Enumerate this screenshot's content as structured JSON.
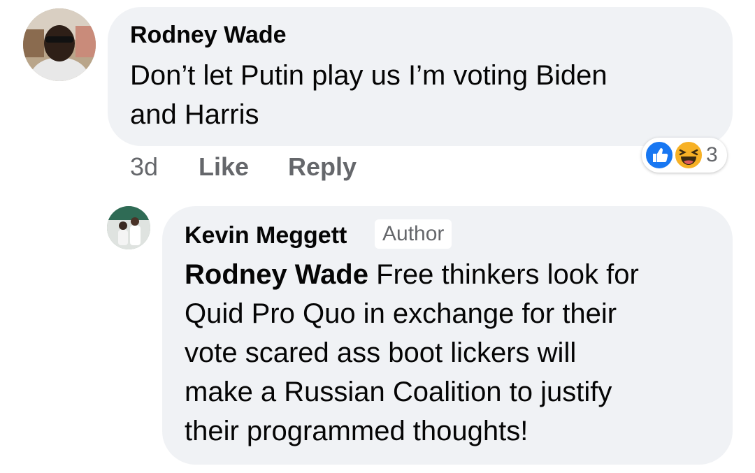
{
  "comments": [
    {
      "author": "Rodney Wade",
      "text_lines": [
        "Don’t let Putin play us I’m voting Biden",
        "and Harris"
      ],
      "actions": {
        "time": "3d",
        "like": "Like",
        "reply": "Reply"
      },
      "reactions": {
        "icons": [
          "like-reaction",
          "haha-reaction"
        ],
        "count": "3"
      }
    },
    {
      "author": "Kevin Meggett",
      "badge": "Author",
      "mention": "Rodney Wade",
      "text_lines": [
        " Free thinkers look for",
        "Quid Pro Quo in exchange for their",
        "vote scared ass boot lickers will",
        "make a Russian Coalition to justify",
        "their programmed thoughts!"
      ]
    }
  ],
  "colors": {
    "bubble": "#f0f2f5",
    "text": "#050505",
    "secondary": "#65676b",
    "like_blue": "#1877f2",
    "haha_yellow": "#f7b125"
  }
}
